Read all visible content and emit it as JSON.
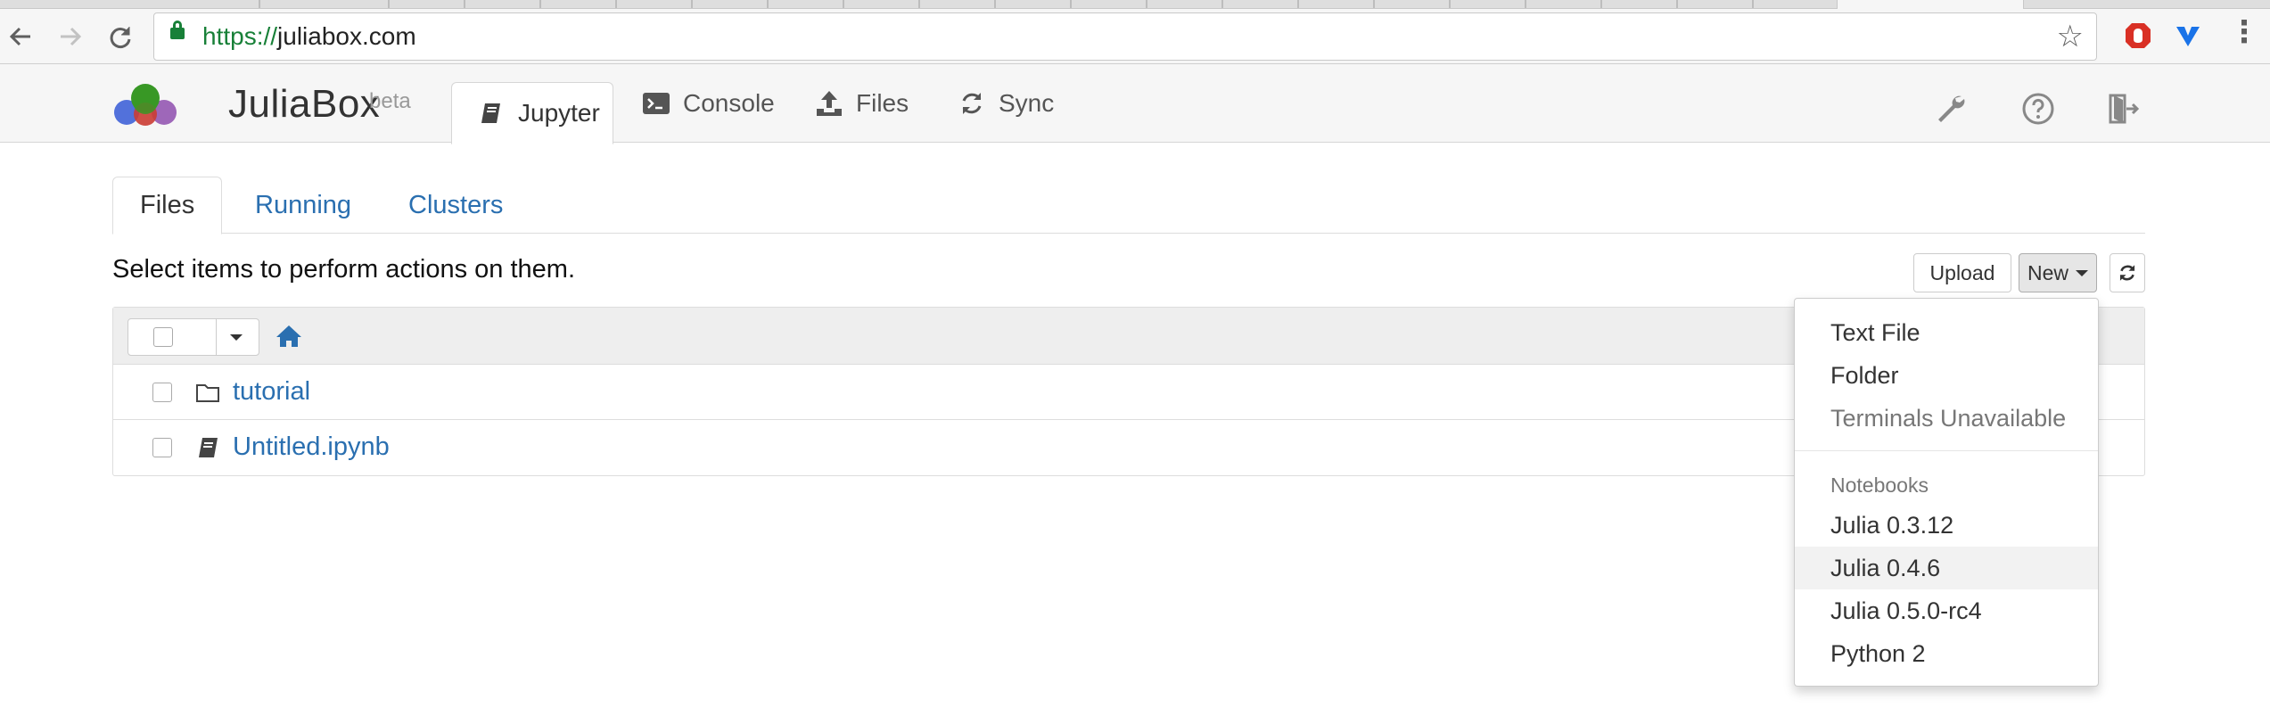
{
  "browser": {
    "url_scheme": "https://",
    "url_host": "juliabox.com"
  },
  "header": {
    "brand": "JuliaBox",
    "brand_sup": "beta",
    "tabs": [
      {
        "label": "Jupyter",
        "icon": "notebook-icon"
      },
      {
        "label": "Console",
        "icon": "terminal-icon"
      },
      {
        "label": "Files",
        "icon": "upload-icon"
      },
      {
        "label": "Sync",
        "icon": "refresh-icon"
      }
    ],
    "right_icons": [
      "wrench-icon",
      "help-icon",
      "logout-icon"
    ]
  },
  "tree": {
    "tabs": [
      "Files",
      "Running",
      "Clusters"
    ],
    "hint": "Select items to perform actions on them.",
    "upload_label": "Upload",
    "new_label": "New",
    "items": [
      {
        "name": "tutorial",
        "icon": "folder-icon"
      },
      {
        "name": "Untitled.ipynb",
        "icon": "notebook-icon"
      }
    ]
  },
  "new_menu": {
    "items": [
      "Text File",
      "Folder",
      "Terminals Unavailable"
    ],
    "notebooks_header": "Notebooks",
    "kernels": [
      "Julia 0.3.12",
      "Julia 0.4.6",
      "Julia 0.5.0-rc4",
      "Python 2"
    ],
    "highlighted": "Julia 0.4.6"
  },
  "colors": {
    "link": "#2a6fb0",
    "secure_green": "#188038",
    "header_bg": "#f6f6f6"
  }
}
